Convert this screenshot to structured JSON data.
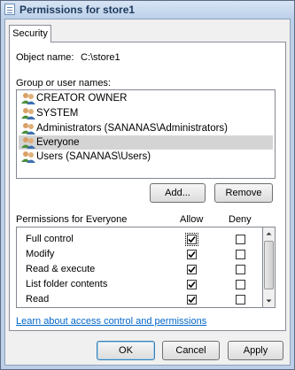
{
  "window": {
    "title": "Permissions for store1"
  },
  "tabs": [
    {
      "label": "Security"
    }
  ],
  "object": {
    "label": "Object name:",
    "value": "C:\\store1"
  },
  "group_list": {
    "label": "Group or user names:",
    "items": [
      {
        "label": "CREATOR OWNER",
        "selected": false
      },
      {
        "label": "SYSTEM",
        "selected": false
      },
      {
        "label": "Administrators (SANANAS\\Administrators)",
        "selected": false
      },
      {
        "label": "Everyone",
        "selected": true
      },
      {
        "label": "Users (SANANAS\\Users)",
        "selected": false
      }
    ]
  },
  "buttons": {
    "add": "Add...",
    "remove": "Remove",
    "ok": "OK",
    "cancel": "Cancel",
    "apply": "Apply"
  },
  "permissions": {
    "header": "Permissions for Everyone",
    "allow_header": "Allow",
    "deny_header": "Deny",
    "rows": [
      {
        "name": "Full control",
        "allow": true,
        "deny": false
      },
      {
        "name": "Modify",
        "allow": true,
        "deny": false
      },
      {
        "name": "Read & execute",
        "allow": true,
        "deny": false
      },
      {
        "name": "List folder contents",
        "allow": true,
        "deny": false
      },
      {
        "name": "Read",
        "allow": true,
        "deny": false
      }
    ]
  },
  "link": "Learn about access control and permissions"
}
